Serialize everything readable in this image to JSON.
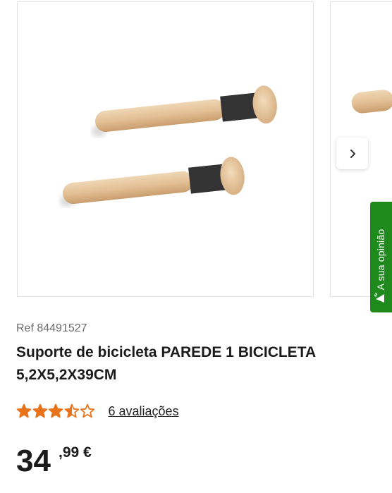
{
  "product": {
    "ref": "Ref 84491527",
    "title": "Suporte de bicicleta PAREDE 1 BICICLETA 5,2X5,2X39CM",
    "rating": 3.5,
    "reviews_label": "6 avaliações",
    "price_int": "34",
    "price_dec": ",99 €"
  },
  "feedback_tab": {
    "label": "A sua opinião"
  },
  "colors": {
    "star": "#e8731a",
    "feedback_green": "#1f8a1c"
  }
}
